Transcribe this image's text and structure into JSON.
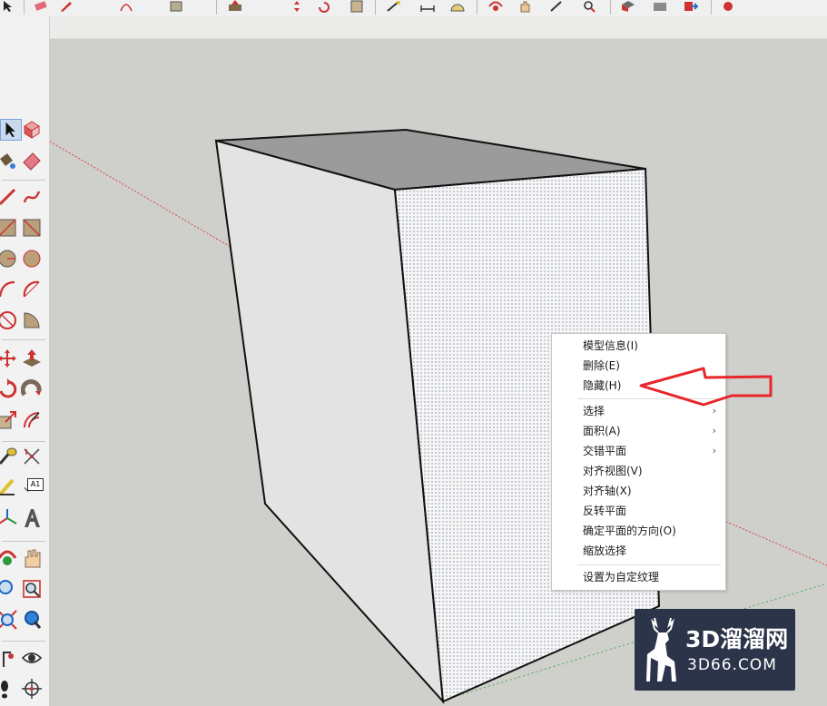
{
  "context_menu": {
    "items": [
      {
        "label": "模型信息(I)",
        "has_submenu": false
      },
      {
        "label": "删除(E)",
        "has_submenu": false
      },
      {
        "label": "隐藏(H)",
        "has_submenu": false
      },
      {
        "label": "选择",
        "has_submenu": true
      },
      {
        "label": "面积(A)",
        "has_submenu": true
      },
      {
        "label": "交错平面",
        "has_submenu": true
      },
      {
        "label": "对齐视图(V)",
        "has_submenu": false
      },
      {
        "label": "对齐轴(X)",
        "has_submenu": false
      },
      {
        "label": "反转平面",
        "has_submenu": false
      },
      {
        "label": "确定平面的方向(O)",
        "has_submenu": false
      },
      {
        "label": "缩放选择",
        "has_submenu": false
      },
      {
        "label": "设置为自定纹理",
        "has_submenu": false
      }
    ],
    "submenu_glyph": "›"
  },
  "toolbar": {
    "text_tool_label": "A1"
  },
  "watermark": {
    "main_text": "3D溜溜网",
    "url_text": "3D66.COM"
  },
  "colors": {
    "viewport_bg": "#cfcfcb",
    "annotation_red": "#e8262b",
    "axis_red": "#d24a4a",
    "axis_green": "#4caf50",
    "watermark_bg": "#2b3449"
  }
}
